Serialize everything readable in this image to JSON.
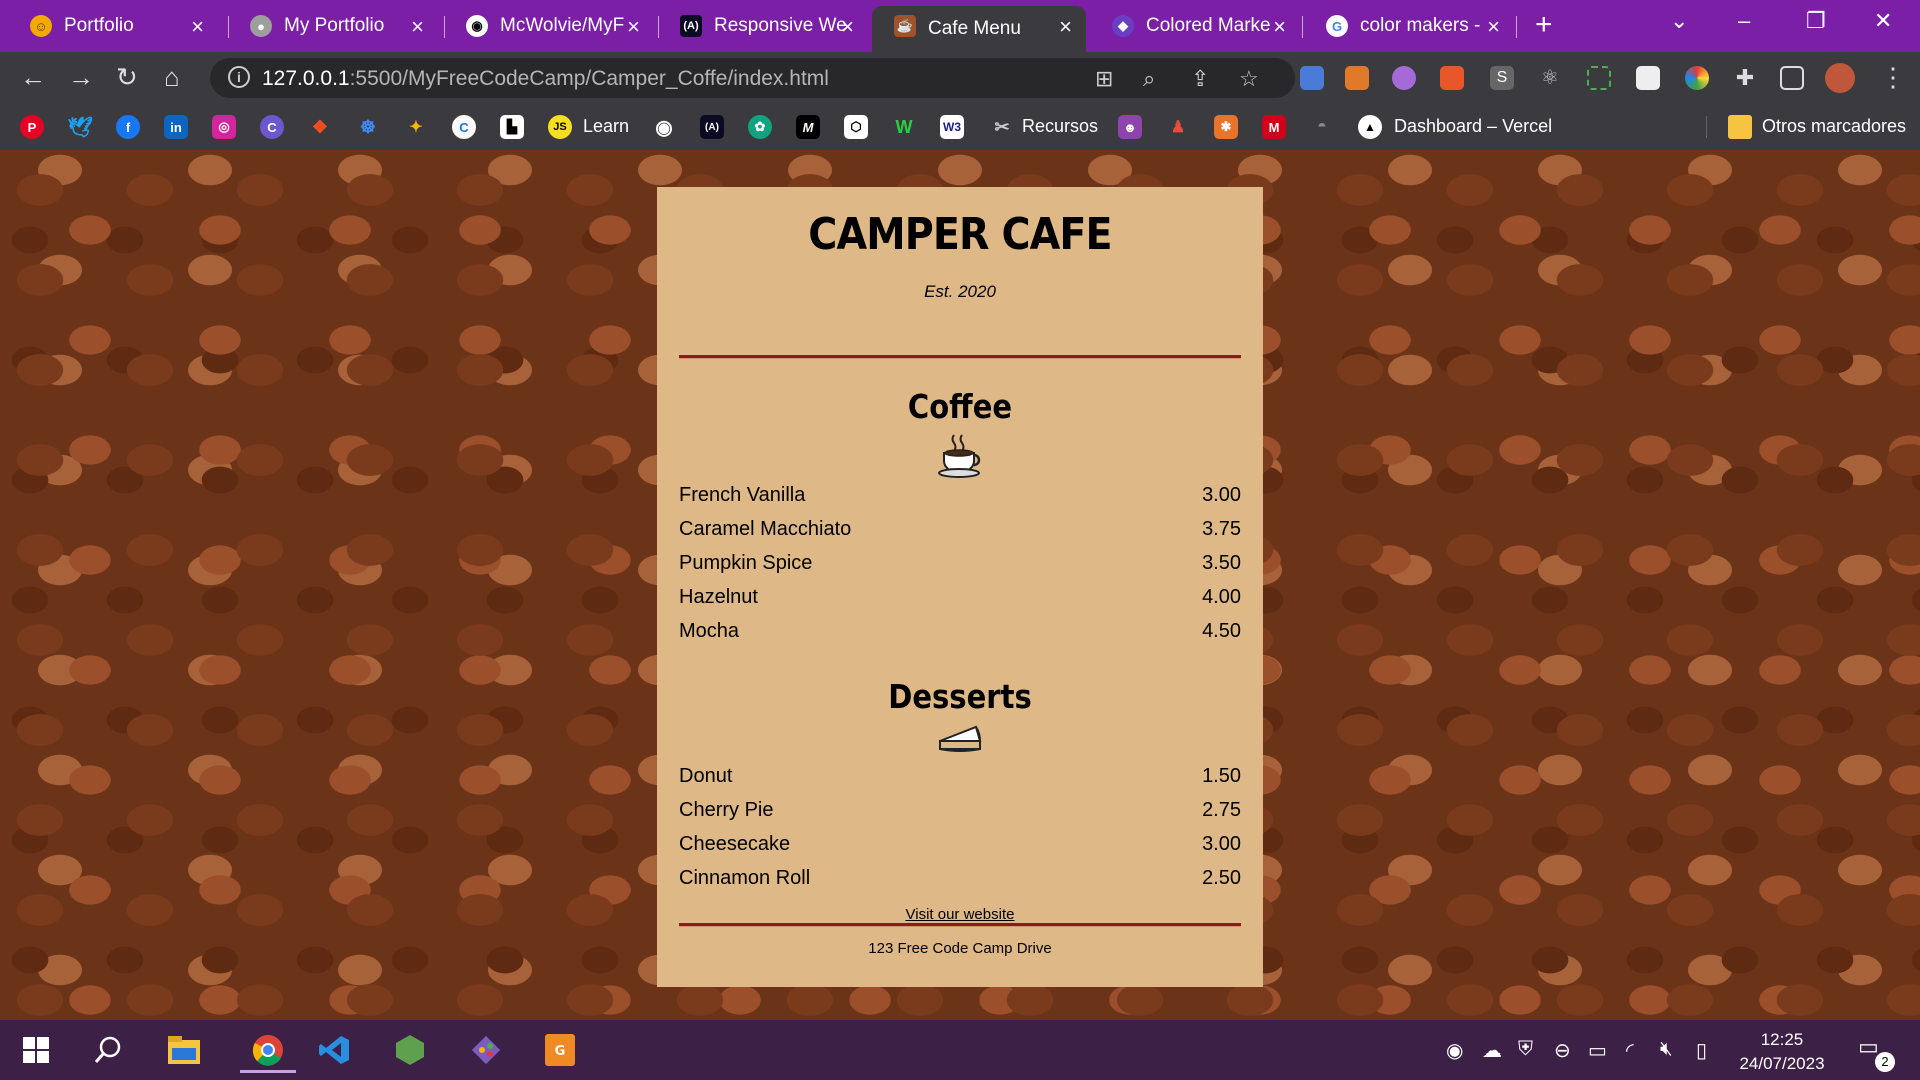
{
  "browser": {
    "tabs": [
      {
        "label": "Portfolio",
        "icon": "smiley-logo-icon",
        "color": "#f2a900"
      },
      {
        "label": "My Portfolio",
        "icon": "globe-icon",
        "color": "#9e9e9e"
      },
      {
        "label": "McWolvie/MyF",
        "icon": "github-icon",
        "color": "#ffffff"
      },
      {
        "label": "Responsive We",
        "icon": "freecodecamp-icon",
        "color": "#0a0a23"
      },
      {
        "label": "Cafe Menu",
        "icon": "cafe-icon",
        "color": "#a0522d",
        "active": true
      },
      {
        "label": "Colored Marke",
        "icon": "colored-icon",
        "color": "#6a3ec2"
      },
      {
        "label": "color makers -",
        "icon": "google-icon",
        "color": "#ffffff"
      }
    ],
    "url_host": "127.0.0.1",
    "url_path": ":5500/MyFreeCodeCamp/Camper_Coffe/index.html",
    "bookmarks": {
      "learn": "Learn",
      "recursos": "Recursos",
      "dashboard": "Dashboard – Vercel",
      "otros": "Otros marcadores"
    }
  },
  "menu": {
    "cafe_name": "CAMPER CAFE",
    "established": "Est. 2020",
    "sections": [
      {
        "title": "Coffee",
        "icon": "coffee-cup-icon",
        "items": [
          {
            "name": "French Vanilla",
            "price": "3.00"
          },
          {
            "name": "Caramel Macchiato",
            "price": "3.75"
          },
          {
            "name": "Pumpkin Spice",
            "price": "3.50"
          },
          {
            "name": "Hazelnut",
            "price": "4.00"
          },
          {
            "name": "Mocha",
            "price": "4.50"
          }
        ]
      },
      {
        "title": "Desserts",
        "icon": "pie-slice-icon",
        "items": [
          {
            "name": "Donut",
            "price": "1.50"
          },
          {
            "name": "Cherry Pie",
            "price": "2.75"
          },
          {
            "name": "Cheesecake",
            "price": "3.00"
          },
          {
            "name": "Cinnamon Roll",
            "price": "2.50"
          }
        ]
      }
    ],
    "website_link": "Visit our website",
    "address": "123 Free Code Camp Drive"
  },
  "taskbar": {
    "time": "12:25",
    "date": "24/07/2023",
    "notification_count": "2"
  },
  "colors": {
    "tabbar": "#7a1fa6",
    "menu_background": "#deb887",
    "divider": "#8b1a1a",
    "taskbar": "#3d2046"
  }
}
